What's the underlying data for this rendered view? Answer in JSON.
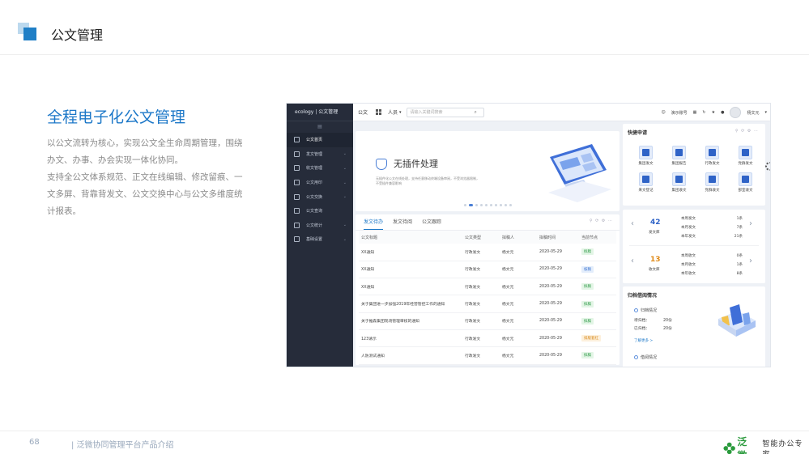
{
  "slide": {
    "title": "公文管理",
    "heading": "全程电子化公文管理",
    "description": [
      "以公文流转为核心，实现公文全生命周期管理，围绕",
      "办文、办事、办会实现一体化协同。",
      "支持全公文体系规范、正文在线编辑、修改留痕、一",
      "文多屏、背靠背发文、公文交换中心与公文多维度统",
      "计报表。"
    ],
    "page_number": "68",
    "footer_text": "| 泛微协同管理平台产品介绍",
    "logo_name": "泛微",
    "logo_slogan": "智能办公专家"
  },
  "app": {
    "brand": "ecology  |  公文管理",
    "sidebar": [
      {
        "label": "公文首页",
        "active": true
      },
      {
        "label": "发文管理"
      },
      {
        "label": "收文管理"
      },
      {
        "label": "公文用印"
      },
      {
        "label": "公文交换"
      },
      {
        "label": "公文查询"
      },
      {
        "label": "公文统计"
      },
      {
        "label": "基础设置"
      }
    ],
    "topbar": {
      "module": "公文",
      "select_label": "人员",
      "search_placeholder": "请输入关键词搜索",
      "account_label": "演示账号",
      "user_name": "杨文元"
    },
    "banner": {
      "title": "无插件处理",
      "subtitle": "无插件化公文在线处理，支持任意移动终端设备审阅，不受浏览器限制，不受插件兼容影响"
    },
    "docs": {
      "tabs": [
        "发文待办",
        "发文待阅",
        "公文跟踪"
      ],
      "columns": [
        "公文标题",
        "公文类型",
        "拟稿人",
        "拟稿时间",
        "当前节点"
      ],
      "rows": [
        {
          "title": "XX通知",
          "type": "行政发文",
          "author": "杨文元",
          "date": "2020-05-29",
          "node": "拟稿",
          "tone": "green"
        },
        {
          "title": "XX通知",
          "type": "行政发文",
          "author": "杨文元",
          "date": "2020-05-29",
          "node": "核稿",
          "tone": "blue"
        },
        {
          "title": "XX通知",
          "type": "行政发文",
          "author": "杨文元",
          "date": "2020-05-29",
          "node": "拟稿",
          "tone": "green"
        },
        {
          "title": "关于集团进一步加强2019年经营管控工作的通知",
          "type": "行政发文",
          "author": "杨文元",
          "date": "2020-05-29",
          "node": "拟稿",
          "tone": "green"
        },
        {
          "title": "关于推森集团现场管理审核的通知",
          "type": "行政发文",
          "author": "杨文元",
          "date": "2020-05-29",
          "node": "拟稿",
          "tone": "green"
        },
        {
          "title": "123请示",
          "type": "行政发文",
          "author": "杨文元",
          "date": "2020-05-29",
          "node": "排版套红",
          "tone": "orange"
        },
        {
          "title": "人防测试通知",
          "type": "行政发文",
          "author": "杨文元",
          "date": "2020-05-29",
          "node": "拟稿",
          "tone": "green"
        }
      ]
    },
    "quick": {
      "title": "快捷申请",
      "items": [
        "集团发文",
        "集团报告",
        "行政发文",
        "党群发文",
        "来文登记",
        "集团收文",
        "党群收文",
        "部室收文"
      ]
    },
    "stats": [
      {
        "number": "42",
        "name": "发文库",
        "color": "#2f63c7",
        "rows": [
          [
            "本周发文",
            "1条"
          ],
          [
            "本月发文",
            "7条"
          ],
          [
            "本年发文",
            "21条"
          ]
        ]
      },
      {
        "number": "13",
        "name": "收文库",
        "color": "#e08b1a",
        "rows": [
          [
            "本周收文",
            "0条"
          ],
          [
            "本月收文",
            "1条"
          ],
          [
            "本年收文",
            "8条"
          ]
        ]
      }
    ],
    "archive": {
      "title": "归档借阅情况",
      "subtitle": "归档情况",
      "rows": [
        [
          "待归档：",
          "20份"
        ],
        [
          "已归档：",
          "20份"
        ]
      ],
      "more": "了解更多 >",
      "subtitle2": "借阅情况"
    }
  }
}
